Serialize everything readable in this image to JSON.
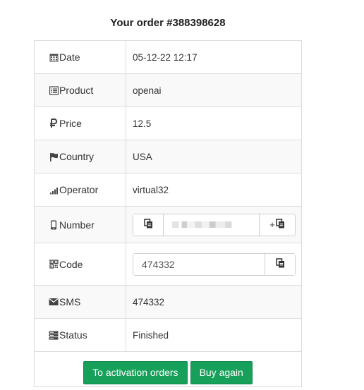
{
  "title": "Your order #388398628",
  "rows": {
    "date": {
      "label": "Date",
      "value": "05-12-22 12:17"
    },
    "product": {
      "label": "Product",
      "value": "openai"
    },
    "price": {
      "label": "Price",
      "value": "12.5"
    },
    "country": {
      "label": "Country",
      "value": "USA"
    },
    "operator": {
      "label": "Operator",
      "value": "virtual32"
    },
    "number": {
      "label": "Number",
      "plus_label": "+"
    },
    "code": {
      "label": "Code",
      "value": "474332"
    },
    "sms": {
      "label": "SMS",
      "value": "474332"
    },
    "status": {
      "label": "Status",
      "value": "Finished"
    }
  },
  "actions": {
    "activation_orders": "To activation orders",
    "buy_again": "Buy again"
  },
  "colors": {
    "accent": "#16a05a",
    "border": "#dcdcdc",
    "stripe": "#f9f9f9"
  },
  "icons": [
    "calendar-icon",
    "list-icon",
    "ruble-icon",
    "flag-icon",
    "signal-icon",
    "phone-icon",
    "qrcode-icon",
    "envelope-icon",
    "server-icon",
    "copy-icon"
  ]
}
